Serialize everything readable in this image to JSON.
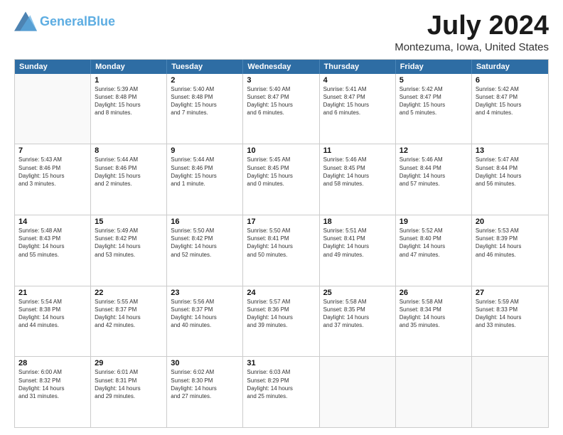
{
  "header": {
    "logo_general": "General",
    "logo_blue": "Blue",
    "main_title": "July 2024",
    "subtitle": "Montezuma, Iowa, United States"
  },
  "calendar": {
    "days": [
      "Sunday",
      "Monday",
      "Tuesday",
      "Wednesday",
      "Thursday",
      "Friday",
      "Saturday"
    ],
    "rows": [
      [
        {
          "day": "",
          "lines": []
        },
        {
          "day": "1",
          "lines": [
            "Sunrise: 5:39 AM",
            "Sunset: 8:48 PM",
            "Daylight: 15 hours",
            "and 8 minutes."
          ]
        },
        {
          "day": "2",
          "lines": [
            "Sunrise: 5:40 AM",
            "Sunset: 8:48 PM",
            "Daylight: 15 hours",
            "and 7 minutes."
          ]
        },
        {
          "day": "3",
          "lines": [
            "Sunrise: 5:40 AM",
            "Sunset: 8:47 PM",
            "Daylight: 15 hours",
            "and 6 minutes."
          ]
        },
        {
          "day": "4",
          "lines": [
            "Sunrise: 5:41 AM",
            "Sunset: 8:47 PM",
            "Daylight: 15 hours",
            "and 6 minutes."
          ]
        },
        {
          "day": "5",
          "lines": [
            "Sunrise: 5:42 AM",
            "Sunset: 8:47 PM",
            "Daylight: 15 hours",
            "and 5 minutes."
          ]
        },
        {
          "day": "6",
          "lines": [
            "Sunrise: 5:42 AM",
            "Sunset: 8:47 PM",
            "Daylight: 15 hours",
            "and 4 minutes."
          ]
        }
      ],
      [
        {
          "day": "7",
          "lines": [
            "Sunrise: 5:43 AM",
            "Sunset: 8:46 PM",
            "Daylight: 15 hours",
            "and 3 minutes."
          ]
        },
        {
          "day": "8",
          "lines": [
            "Sunrise: 5:44 AM",
            "Sunset: 8:46 PM",
            "Daylight: 15 hours",
            "and 2 minutes."
          ]
        },
        {
          "day": "9",
          "lines": [
            "Sunrise: 5:44 AM",
            "Sunset: 8:46 PM",
            "Daylight: 15 hours",
            "and 1 minute."
          ]
        },
        {
          "day": "10",
          "lines": [
            "Sunrise: 5:45 AM",
            "Sunset: 8:45 PM",
            "Daylight: 15 hours",
            "and 0 minutes."
          ]
        },
        {
          "day": "11",
          "lines": [
            "Sunrise: 5:46 AM",
            "Sunset: 8:45 PM",
            "Daylight: 14 hours",
            "and 58 minutes."
          ]
        },
        {
          "day": "12",
          "lines": [
            "Sunrise: 5:46 AM",
            "Sunset: 8:44 PM",
            "Daylight: 14 hours",
            "and 57 minutes."
          ]
        },
        {
          "day": "13",
          "lines": [
            "Sunrise: 5:47 AM",
            "Sunset: 8:44 PM",
            "Daylight: 14 hours",
            "and 56 minutes."
          ]
        }
      ],
      [
        {
          "day": "14",
          "lines": [
            "Sunrise: 5:48 AM",
            "Sunset: 8:43 PM",
            "Daylight: 14 hours",
            "and 55 minutes."
          ]
        },
        {
          "day": "15",
          "lines": [
            "Sunrise: 5:49 AM",
            "Sunset: 8:42 PM",
            "Daylight: 14 hours",
            "and 53 minutes."
          ]
        },
        {
          "day": "16",
          "lines": [
            "Sunrise: 5:50 AM",
            "Sunset: 8:42 PM",
            "Daylight: 14 hours",
            "and 52 minutes."
          ]
        },
        {
          "day": "17",
          "lines": [
            "Sunrise: 5:50 AM",
            "Sunset: 8:41 PM",
            "Daylight: 14 hours",
            "and 50 minutes."
          ]
        },
        {
          "day": "18",
          "lines": [
            "Sunrise: 5:51 AM",
            "Sunset: 8:41 PM",
            "Daylight: 14 hours",
            "and 49 minutes."
          ]
        },
        {
          "day": "19",
          "lines": [
            "Sunrise: 5:52 AM",
            "Sunset: 8:40 PM",
            "Daylight: 14 hours",
            "and 47 minutes."
          ]
        },
        {
          "day": "20",
          "lines": [
            "Sunrise: 5:53 AM",
            "Sunset: 8:39 PM",
            "Daylight: 14 hours",
            "and 46 minutes."
          ]
        }
      ],
      [
        {
          "day": "21",
          "lines": [
            "Sunrise: 5:54 AM",
            "Sunset: 8:38 PM",
            "Daylight: 14 hours",
            "and 44 minutes."
          ]
        },
        {
          "day": "22",
          "lines": [
            "Sunrise: 5:55 AM",
            "Sunset: 8:37 PM",
            "Daylight: 14 hours",
            "and 42 minutes."
          ]
        },
        {
          "day": "23",
          "lines": [
            "Sunrise: 5:56 AM",
            "Sunset: 8:37 PM",
            "Daylight: 14 hours",
            "and 40 minutes."
          ]
        },
        {
          "day": "24",
          "lines": [
            "Sunrise: 5:57 AM",
            "Sunset: 8:36 PM",
            "Daylight: 14 hours",
            "and 39 minutes."
          ]
        },
        {
          "day": "25",
          "lines": [
            "Sunrise: 5:58 AM",
            "Sunset: 8:35 PM",
            "Daylight: 14 hours",
            "and 37 minutes."
          ]
        },
        {
          "day": "26",
          "lines": [
            "Sunrise: 5:58 AM",
            "Sunset: 8:34 PM",
            "Daylight: 14 hours",
            "and 35 minutes."
          ]
        },
        {
          "day": "27",
          "lines": [
            "Sunrise: 5:59 AM",
            "Sunset: 8:33 PM",
            "Daylight: 14 hours",
            "and 33 minutes."
          ]
        }
      ],
      [
        {
          "day": "28",
          "lines": [
            "Sunrise: 6:00 AM",
            "Sunset: 8:32 PM",
            "Daylight: 14 hours",
            "and 31 minutes."
          ]
        },
        {
          "day": "29",
          "lines": [
            "Sunrise: 6:01 AM",
            "Sunset: 8:31 PM",
            "Daylight: 14 hours",
            "and 29 minutes."
          ]
        },
        {
          "day": "30",
          "lines": [
            "Sunrise: 6:02 AM",
            "Sunset: 8:30 PM",
            "Daylight: 14 hours",
            "and 27 minutes."
          ]
        },
        {
          "day": "31",
          "lines": [
            "Sunrise: 6:03 AM",
            "Sunset: 8:29 PM",
            "Daylight: 14 hours",
            "and 25 minutes."
          ]
        },
        {
          "day": "",
          "lines": []
        },
        {
          "day": "",
          "lines": []
        },
        {
          "day": "",
          "lines": []
        }
      ]
    ]
  }
}
